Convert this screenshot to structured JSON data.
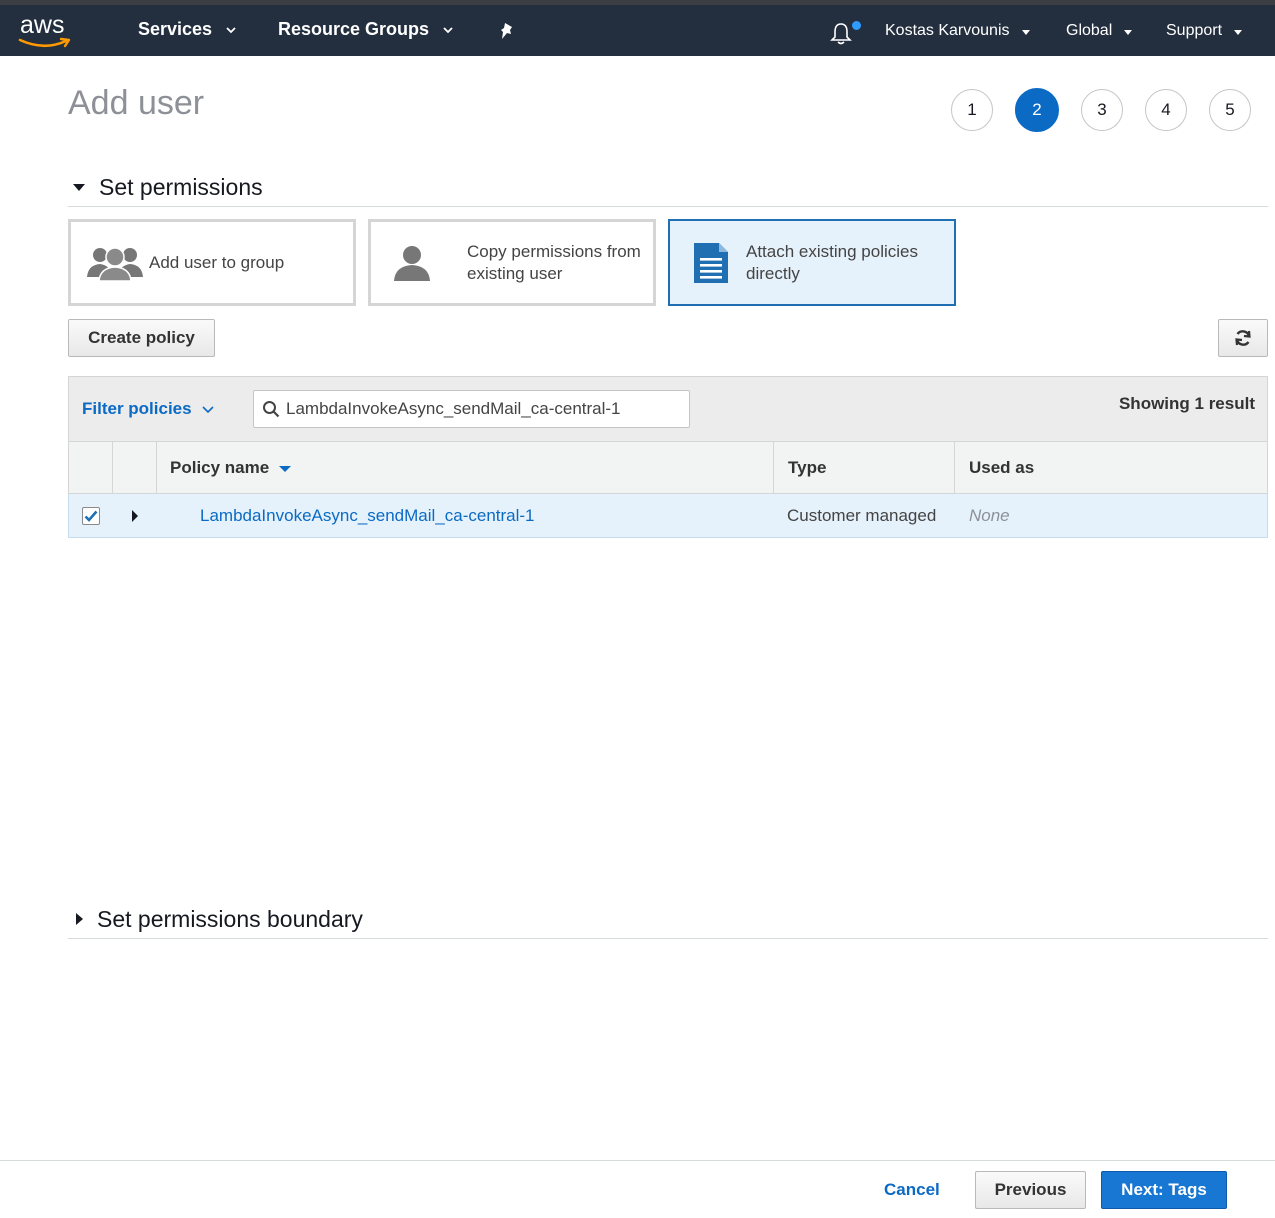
{
  "nav": {
    "logo_text": "aws",
    "services": "Services",
    "resource_groups": "Resource Groups",
    "user": "Kostas Karvounis",
    "region": "Global",
    "support": "Support"
  },
  "page": {
    "title": "Add user"
  },
  "steps": [
    "1",
    "2",
    "3",
    "4",
    "5"
  ],
  "active_step": 2,
  "section_permissions": {
    "title": "Set permissions"
  },
  "options": [
    {
      "label": "Add user to group",
      "selected": false
    },
    {
      "label_line1": "Copy permissions from",
      "label_line2": "existing user",
      "selected": false
    },
    {
      "label_line1": "Attach existing policies",
      "label_line2": "directly",
      "selected": true
    }
  ],
  "toolbar": {
    "create_policy": "Create policy"
  },
  "filter": {
    "filter_label": "Filter policies",
    "search_value": "LambdaInvokeAsync_sendMail_ca-central-1",
    "showing": "Showing 1 result"
  },
  "table": {
    "columns": [
      "Policy name",
      "Type",
      "Used as"
    ],
    "rows": [
      {
        "checked": true,
        "name": "LambdaInvokeAsync_sendMail_ca-central-1",
        "type": "Customer managed",
        "used_as": "None"
      }
    ]
  },
  "section_boundary": {
    "title": "Set permissions boundary"
  },
  "footer": {
    "cancel": "Cancel",
    "previous": "Previous",
    "next": "Next: Tags"
  },
  "colors": {
    "nav_bg": "#232f3e",
    "accent": "#0b6ac4",
    "selected_bg": "#e6f2fb",
    "next_btn": "#1877d2"
  }
}
